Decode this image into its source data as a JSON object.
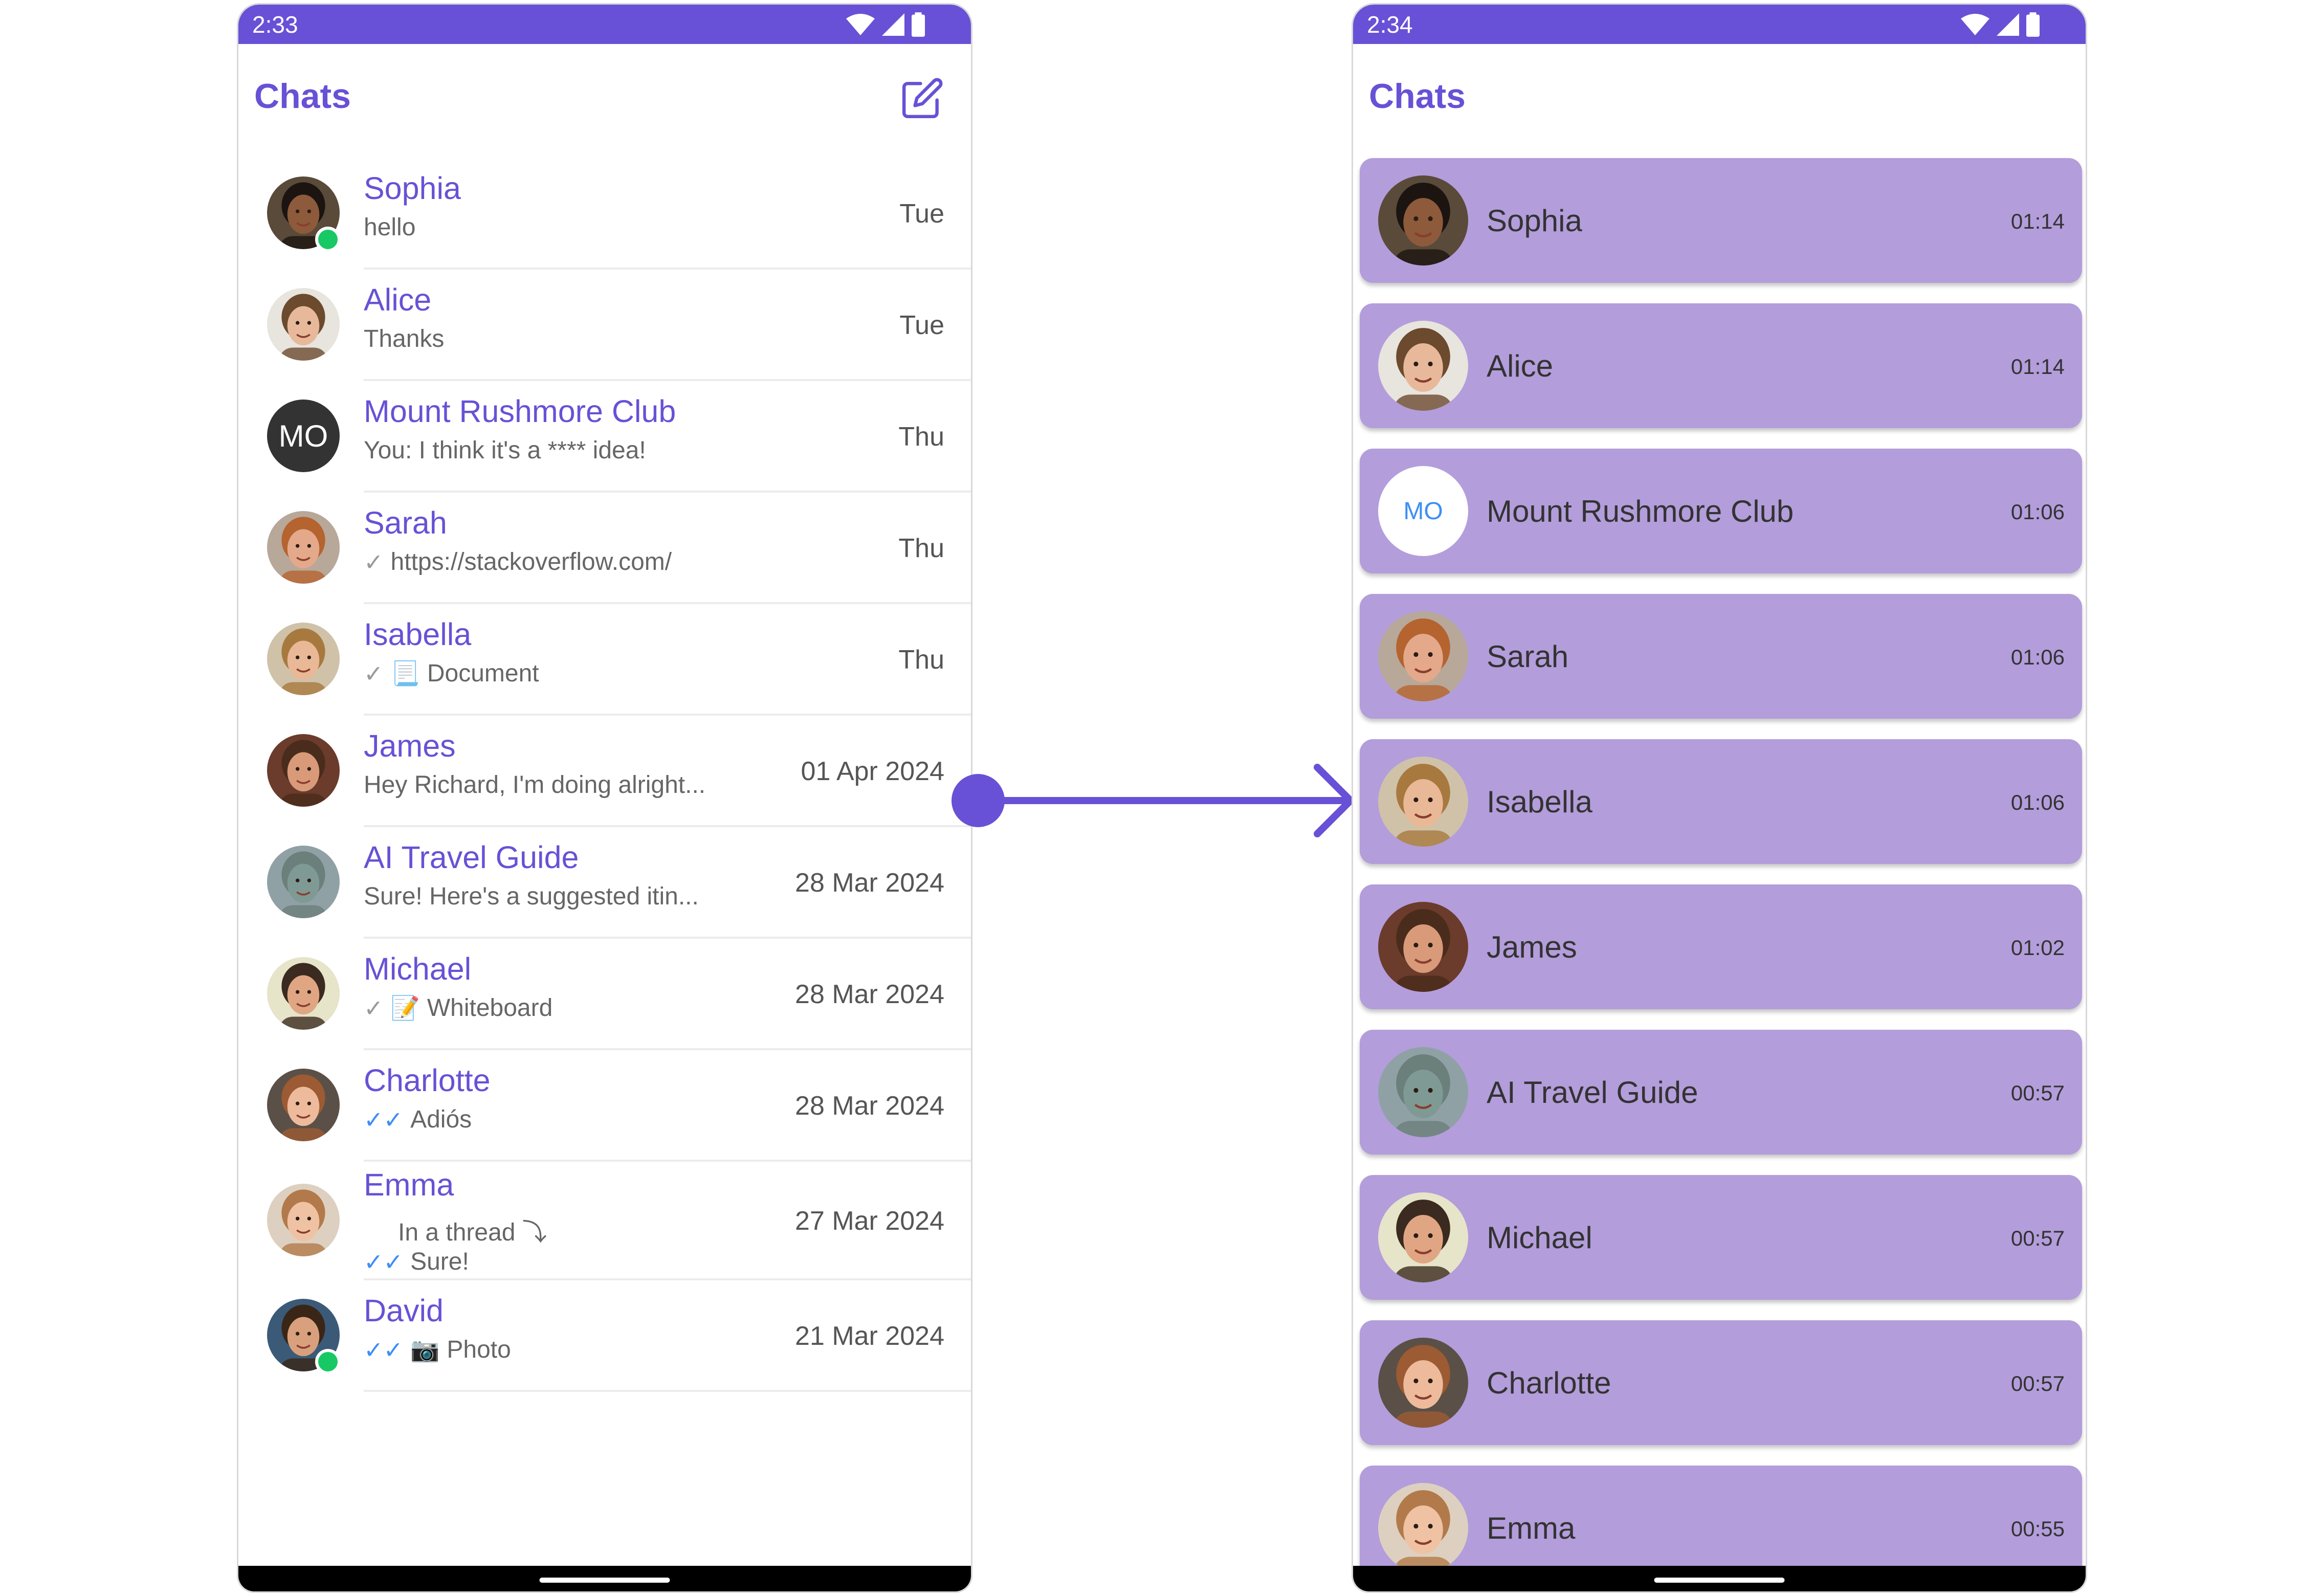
{
  "left_phone": {
    "status_time": "2:33",
    "title": "Chats",
    "chats": [
      {
        "name": "Sophia",
        "sub": "hello",
        "tick": "",
        "emoji": "",
        "time": "Tue",
        "online": true,
        "avatar": "sophia"
      },
      {
        "name": "Alice",
        "sub": "Thanks",
        "tick": "",
        "emoji": "",
        "time": "Tue",
        "online": false,
        "avatar": "alice"
      },
      {
        "name": "Mount Rushmore Club",
        "sub": "You: I think it's a **** idea!",
        "tick": "",
        "emoji": "",
        "time": "Thu",
        "online": false,
        "initials": "MO"
      },
      {
        "name": "Sarah",
        "sub": "https://stackoverflow.com/",
        "tick": "✓",
        "emoji": "",
        "time": "Thu",
        "online": false,
        "avatar": "sarah"
      },
      {
        "name": "Isabella",
        "sub": "Document",
        "tick": "✓",
        "emoji": "📃",
        "time": "Thu",
        "online": false,
        "avatar": "isabella"
      },
      {
        "name": "James",
        "sub": "Hey Richard, I'm doing alright...",
        "tick": "",
        "emoji": "",
        "time": "01 Apr 2024",
        "online": false,
        "avatar": "james"
      },
      {
        "name": "AI Travel Guide",
        "sub": "Sure! Here's a suggested itin...",
        "tick": "",
        "emoji": "",
        "time": "28 Mar 2024",
        "online": false,
        "avatar": "liberty"
      },
      {
        "name": "Michael",
        "sub": "Whiteboard",
        "tick": "✓",
        "emoji": "📝",
        "time": "28 Mar 2024",
        "online": false,
        "avatar": "michael"
      },
      {
        "name": "Charlotte",
        "sub": "Adiós",
        "tick": "✓✓",
        "emoji": "",
        "time": "28 Mar 2024",
        "online": false,
        "avatar": "charlotte"
      },
      {
        "name": "Emma",
        "thread": "In a thread ⤵",
        "sub": "Sure!",
        "tick": "✓✓",
        "emoji": "",
        "time": "27 Mar 2024",
        "online": false,
        "avatar": "emma"
      },
      {
        "name": "David",
        "sub": "Photo",
        "tick": "✓✓",
        "emoji": "📷",
        "time": "21 Mar 2024",
        "online": true,
        "avatar": "david"
      }
    ]
  },
  "right_phone": {
    "status_time": "2:34",
    "title": "Chats",
    "chats": [
      {
        "name": "Sophia",
        "time": "01:14",
        "avatar": "sophia"
      },
      {
        "name": "Alice",
        "time": "01:14",
        "avatar": "alice"
      },
      {
        "name": "Mount Rushmore Club",
        "time": "01:06",
        "initials": "MO"
      },
      {
        "name": "Sarah",
        "time": "01:06",
        "avatar": "sarah"
      },
      {
        "name": "Isabella",
        "time": "01:06",
        "avatar": "isabella"
      },
      {
        "name": "James",
        "time": "01:02",
        "avatar": "james"
      },
      {
        "name": "AI Travel Guide",
        "time": "00:57",
        "avatar": "liberty"
      },
      {
        "name": "Michael",
        "time": "00:57",
        "avatar": "michael"
      },
      {
        "name": "Charlotte",
        "time": "00:57",
        "avatar": "charlotte"
      },
      {
        "name": "Emma",
        "time": "00:55",
        "avatar": "emma"
      }
    ]
  },
  "colors": {
    "accent": "#6851d6",
    "card_bg": "#b39ddb",
    "online": "#17c964",
    "read_tick": "#3e8ef7"
  },
  "avatars": {
    "sophia": {
      "bg": "#5a4a3a",
      "skin": "#8d5a3b",
      "hair": "#1c1410"
    },
    "alice": {
      "bg": "#e8e4de",
      "skin": "#e7b99a",
      "hair": "#6b4a2e"
    },
    "sarah": {
      "bg": "#b7a89a",
      "skin": "#e3a98a",
      "hair": "#b5632f"
    },
    "isabella": {
      "bg": "#cfc2a9",
      "skin": "#e9b896",
      "hair": "#a8793e"
    },
    "james": {
      "bg": "#6b3b2b",
      "skin": "#d99a7a",
      "hair": "#4a2c1c"
    },
    "liberty": {
      "bg": "#8fa1a5",
      "skin": "#7f9a94",
      "hair": "#6b7f7b"
    },
    "michael": {
      "bg": "#e6e4c9",
      "skin": "#e0a683",
      "hair": "#3b2a1f"
    },
    "charlotte": {
      "bg": "#5a5048",
      "skin": "#edbb9c",
      "hair": "#9c5b33"
    },
    "emma": {
      "bg": "#ded0c0",
      "skin": "#efc2a3",
      "hair": "#b27a4a"
    },
    "david": {
      "bg": "#3b5a78",
      "skin": "#d8a07c",
      "hair": "#3a2617"
    }
  }
}
